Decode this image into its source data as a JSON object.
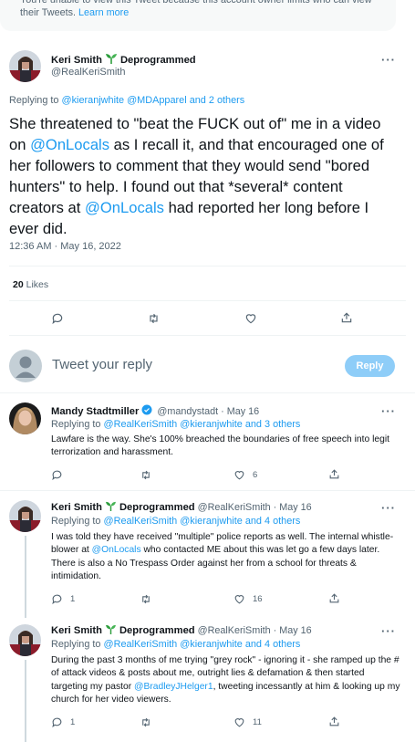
{
  "notice": {
    "text": "You're unable to view this Tweet because this account owner limits who can view their Tweets.",
    "link": "Learn more"
  },
  "main_tweet": {
    "name_first": "Keri Smith",
    "name_second": "Deprogrammed",
    "handle": "@RealKeriSmith",
    "more": "···",
    "replying_prefix": "Replying to",
    "replying_to": "@kieranjwhite @MDApparel",
    "replying_suffix": "and 2 others",
    "text_parts": [
      "She threatened to \"beat the FUCK out of\" me in a video on ",
      "@OnLocals",
      " as I recall it, and that encouraged one of her followers to comment that they would send \"bored hunters\" to help. I found out that *several* content creators at ",
      "@OnLocals",
      " had reported her long before I ever did."
    ],
    "timestamp": "12:36 AM · May 16, 2022",
    "likes_count": "20",
    "likes_label": "Likes"
  },
  "compose": {
    "placeholder": "Tweet your reply",
    "button": "Reply"
  },
  "replies": [
    {
      "name": "Mandy Stadtmiller",
      "handle_date": "@mandystadt · May 16",
      "replying_prefix": "Replying to",
      "replying_to": "@RealKeriSmith @kieranjwhite",
      "replying_suffix": "and 3 others",
      "text": "Lawfare is the way. She's 100% breached the boundaries of free speech into legit terrorization and harassment.",
      "reply_count": "",
      "like_count": "6"
    },
    {
      "name_first": "Keri Smith",
      "name_second": "Deprogrammed",
      "handle_date": "@RealKeriSmith · May 16",
      "replying_prefix": "Replying to",
      "replying_to": "@RealKeriSmith @kieranjwhite",
      "replying_suffix": "and 4 others",
      "text_a": "I was told they have received \"multiple\" police reports as well. The internal whistle-blower at ",
      "text_link": "@OnLocals",
      "text_b": " who contacted ME about this was let go a few days later. There is also a No Trespass Order against her from a school for threats & intimidation.",
      "reply_count": "1",
      "like_count": "16"
    },
    {
      "name_first": "Keri Smith",
      "name_second": "Deprogrammed",
      "handle_date": "@RealKeriSmith · May 16",
      "replying_prefix": "Replying to",
      "replying_to": "@RealKeriSmith @kieranjwhite",
      "replying_suffix": "and 4 others",
      "text_a": "During the past 3 months of me trying \"grey rock\" - ignoring it - she ramped up the # of attack videos & posts about me, outright lies & defamation & then started targeting my pastor ",
      "text_link": "@BradleyJHelger1",
      "text_b": ", tweeting incessantly at him & looking up my church for her video viewers.",
      "reply_count": "1",
      "like_count": "11"
    }
  ],
  "colors": {
    "accent": "#1d9bf0",
    "secondary_text": "#536471",
    "reply_button": "#8ecdf8",
    "verified": "#1d9bf0",
    "sprout": "#2e9e3e"
  }
}
